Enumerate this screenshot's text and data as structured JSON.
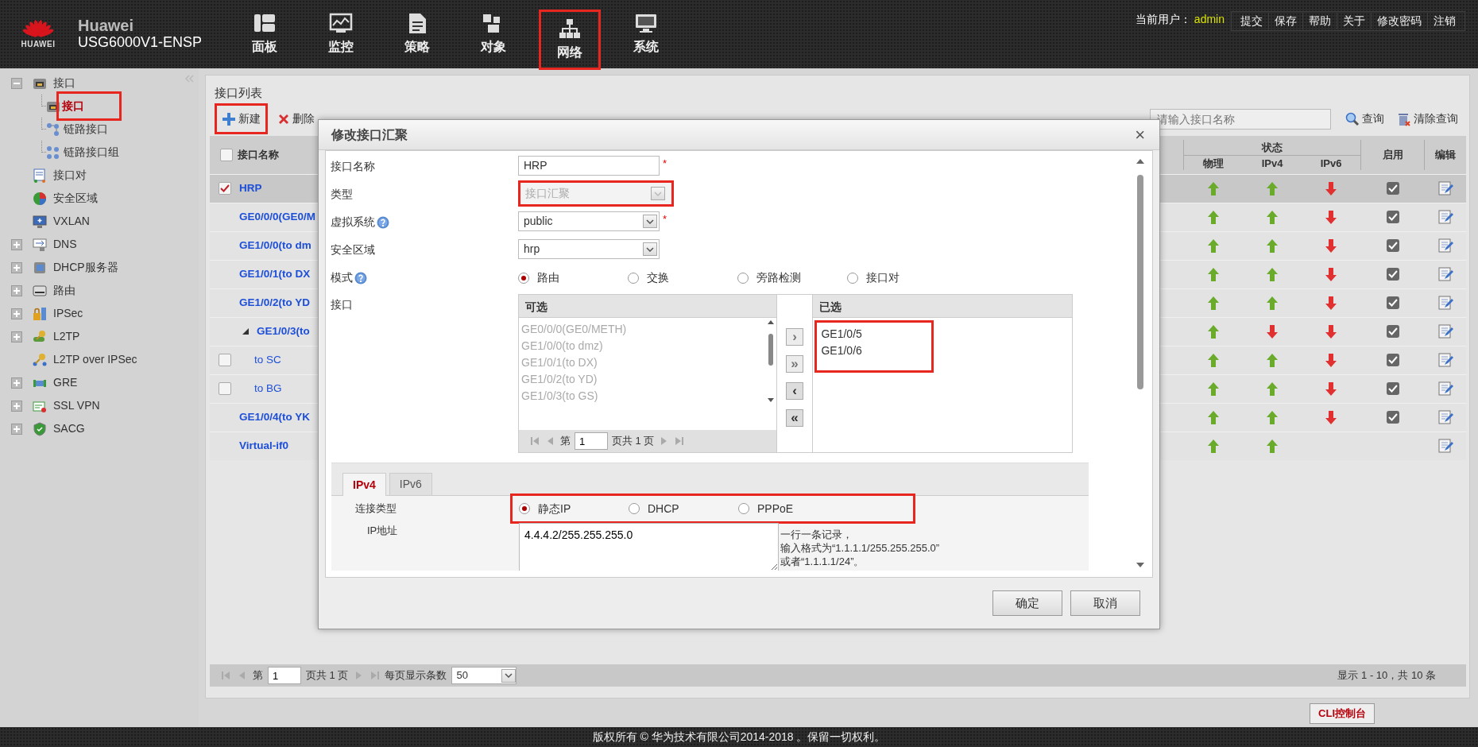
{
  "header": {
    "logo_text": "HUAWEI",
    "product": "Huawei",
    "model": "USG6000V1-ENSP",
    "nav": [
      {
        "label": "面板",
        "highlighted": false
      },
      {
        "label": "监控",
        "highlighted": false
      },
      {
        "label": "策略",
        "highlighted": false
      },
      {
        "label": "对象",
        "highlighted": false
      },
      {
        "label": "网络",
        "highlighted": true
      },
      {
        "label": "系统",
        "highlighted": false
      }
    ],
    "user_label": "当前用户：",
    "user": "admin",
    "links": [
      "提交",
      "保存",
      "帮助",
      "关于",
      "修改密码",
      "注销"
    ]
  },
  "sidebar": {
    "items": [
      {
        "label": "接口",
        "expanded": true,
        "selected": false,
        "children": [
          {
            "label": "接口",
            "selected": true,
            "highlighted": true
          },
          {
            "label": "链路接口",
            "selected": false,
            "highlighted": false
          },
          {
            "label": "链路接口组",
            "selected": false,
            "highlighted": false
          }
        ]
      },
      {
        "label": "接口对",
        "selected": false
      },
      {
        "label": "安全区域",
        "selected": false
      },
      {
        "label": "VXLAN",
        "selected": false
      },
      {
        "label": "DNS",
        "expanded": false,
        "selected": false
      },
      {
        "label": "DHCP服务器",
        "expanded": false,
        "selected": false
      },
      {
        "label": "路由",
        "expanded": false,
        "selected": false
      },
      {
        "label": "IPSec",
        "expanded": false,
        "selected": false
      },
      {
        "label": "L2TP",
        "expanded": false,
        "selected": false
      },
      {
        "label": "L2TP over IPSec",
        "selected": false
      },
      {
        "label": "GRE",
        "expanded": false,
        "selected": false
      },
      {
        "label": "SSL VPN",
        "expanded": false,
        "selected": false
      },
      {
        "label": "SACG",
        "expanded": false,
        "selected": false
      }
    ]
  },
  "list_panel": {
    "title": "接口列表",
    "toolbar": [
      {
        "label": "新建",
        "kind": "add",
        "highlighted": true
      },
      {
        "label": "删除",
        "kind": "delete",
        "highlighted": false
      }
    ],
    "search": {
      "placeholder": "请输入接口名称"
    },
    "search_button": "查询",
    "clear_button": "清除查询",
    "table": {
      "name_column": "接口名称",
      "select_all": false,
      "status_group": "状态",
      "status_columns": [
        "物理",
        "IPv4",
        "IPv6"
      ],
      "enable_column": "启用",
      "edit_column": "编辑",
      "rows": [
        {
          "name": "HRP",
          "checked": true,
          "selected": true,
          "physical_up": true,
          "ipv4_up": true,
          "ipv6_up": false,
          "enabled": true
        },
        {
          "name": "GE0/0/0(GE0/M",
          "selected": false,
          "physical_up": true,
          "ipv4_up": true,
          "ipv6_up": false,
          "enabled": true
        },
        {
          "name": "GE1/0/0(to dm",
          "selected": false,
          "physical_up": true,
          "ipv4_up": true,
          "ipv6_up": false,
          "enabled": true
        },
        {
          "name": "GE1/0/1(to DX",
          "selected": false,
          "physical_up": true,
          "ipv4_up": true,
          "ipv6_up": false,
          "enabled": true
        },
        {
          "name": "GE1/0/2(to YD",
          "selected": false,
          "physical_up": true,
          "ipv4_up": true,
          "ipv6_up": false,
          "enabled": true
        },
        {
          "name": "GE1/0/3(to",
          "selected": false,
          "expanded": true,
          "physical_up": true,
          "ipv4_up": false,
          "ipv6_up": false,
          "enabled": true,
          "children": [
            {
              "name": "to SC",
              "checked": false,
              "selected": false,
              "physical_up": true,
              "ipv4_up": true,
              "ipv6_up": false,
              "enabled": true
            },
            {
              "name": "to BG",
              "checked": false,
              "selected": false,
              "physical_up": true,
              "ipv4_up": true,
              "ipv6_up": false,
              "enabled": true
            }
          ]
        },
        {
          "name": "GE1/0/4(to YK",
          "selected": false,
          "physical_up": true,
          "ipv4_up": true,
          "ipv6_up": false,
          "enabled": true
        },
        {
          "name": "Virtual-if0",
          "selected": false,
          "physical_up": true,
          "ipv4_up": true
        }
      ]
    }
  },
  "pager": {
    "before": "第",
    "page": "1",
    "after": "页共 1 页",
    "per_page_label": "每页显示条数",
    "per_page": "50",
    "summary": "显示 1 - 10，共 10 条"
  },
  "cli_button": "CLI控制台",
  "footer": "版权所有 © 华为技术有限公司2014-2018 。保留一切权利。",
  "dialog": {
    "title": "修改接口汇聚",
    "close": "×",
    "fields": [
      {
        "kind": "text",
        "label": "接口名称",
        "value": "HRP",
        "required_mark": "*",
        "disabled": false
      },
      {
        "kind": "select",
        "label": "类型",
        "value": "接口汇聚",
        "disabled": true,
        "highlighted": true
      },
      {
        "kind": "select",
        "label": "虚拟系统",
        "value": "public",
        "required_mark": "*",
        "help": true,
        "disabled": false
      },
      {
        "kind": "select",
        "label": "安全区域",
        "value": "hrp",
        "disabled": false
      },
      {
        "kind": "radio",
        "label": "模式",
        "help": true,
        "options": [
          {
            "label": "路由",
            "selected": true
          },
          {
            "label": "交换",
            "selected": false
          },
          {
            "label": "旁路检测",
            "selected": false
          },
          {
            "label": "接口对",
            "selected": false
          }
        ]
      },
      {
        "kind": "dual_list",
        "label": "接口",
        "available_title": "可选",
        "available": [
          "GE0/0/0(GE0/METH)",
          "GE1/0/0(to dmz)",
          "GE1/0/1(to DX)",
          "GE1/0/2(to YD)",
          "GE1/0/3(to GS)"
        ],
        "pager_before": "第",
        "page": "1",
        "pager_after": "页共 1 页",
        "move_buttons": [
          {
            "label": "›",
            "disabled": true
          },
          {
            "label": "»",
            "disabled": true
          },
          {
            "label": "‹",
            "disabled": false
          },
          {
            "label": "«",
            "disabled": false
          }
        ],
        "selected_title": "已选",
        "selected_items": [
          "GE1/0/5",
          "GE1/0/6"
        ],
        "highlighted": true
      }
    ],
    "ip_tabs": {
      "tabs": [
        {
          "label": "IPv4",
          "selected": true
        },
        {
          "label": "IPv6",
          "selected": false
        }
      ],
      "connection_label": "连接类型",
      "connection_options": [
        {
          "label": "静态IP",
          "selected": true
        },
        {
          "label": "DHCP",
          "selected": false
        },
        {
          "label": "PPPoE",
          "selected": false
        }
      ],
      "highlighted": true,
      "ip_label": "IP地址",
      "ip_value": "4.4.4.2/255.255.255.0",
      "hint": [
        "一行一条记录，",
        "输入格式为“1.1.1.1/255.255.255.0”",
        "或者“1.1.1.1/24”。"
      ]
    },
    "buttons": [
      "确定",
      "取消"
    ]
  }
}
